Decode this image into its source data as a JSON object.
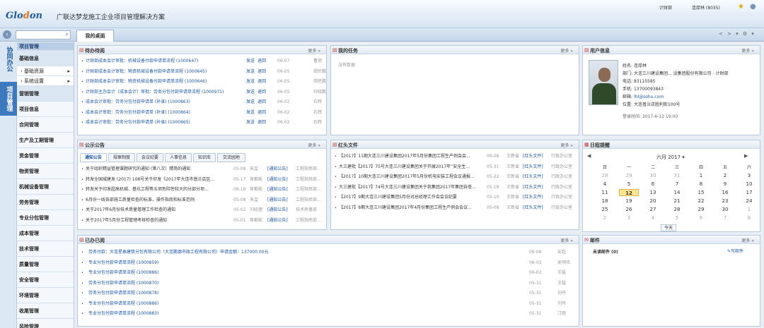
{
  "header": {
    "logo_main": "Glo",
    "logo_accent": "d",
    "logo_tail": "on",
    "title": "广联达梦龙施工企业项目管理解决方案",
    "dept": "计财部",
    "user": "连厚林 (8035)",
    "star_icon": "star-icon",
    "help_icon": "help-icon"
  },
  "tabbar": {
    "search_placeholder": "",
    "active_tab": "我的桌面",
    "tools": "< > ▾ ⚙ ▾"
  },
  "side_tabs": [
    {
      "label": "协同办公"
    },
    {
      "label": "项目管理"
    }
  ],
  "menu": {
    "top": "项目管理",
    "items": [
      {
        "label": "基础信息",
        "type": "group"
      },
      {
        "label": "基础资源",
        "type": "sub"
      },
      {
        "label": "系统设置",
        "type": "sub"
      },
      {
        "label": "营销管理"
      },
      {
        "label": "项目信息"
      },
      {
        "label": "合同管理"
      },
      {
        "label": "生产及工期管理"
      },
      {
        "label": "资金管理"
      },
      {
        "label": "物资管理"
      },
      {
        "label": "机械设备管理"
      },
      {
        "label": "劳务管理"
      },
      {
        "label": "专业分包管理"
      },
      {
        "label": "成本管理"
      },
      {
        "label": "技术管理"
      },
      {
        "label": "质量管理"
      },
      {
        "label": "安全管理"
      },
      {
        "label": "环境管理"
      },
      {
        "label": "收尾管理"
      },
      {
        "label": "风险管理"
      }
    ]
  },
  "todo": {
    "title": "待办待阅",
    "more": "更多 »",
    "rows": [
      {
        "text": "计财部成本会计审批：机械设备付款申请单流程 (1000647)",
        "act1": "发送",
        "act2": "退回",
        "date": "06-07",
        "who": "曹旭"
      },
      {
        "text": "计财部成本会计审批：物资机械设备付款申请单流程 (1000645)",
        "act1": "发送",
        "act2": "退回",
        "date": "06-05",
        "who": "郑民鹏"
      },
      {
        "text": "计财部成本会计审批：物资机械设备付款申请单流程 (1000646)",
        "act1": "发送",
        "act2": "退回",
        "date": "06-05",
        "who": "郑民鹏"
      },
      {
        "text": "计财部主办会计（成本会计）审批：劳务分包付款申请单流程 (1000971)",
        "act1": "发送",
        "act2": "退回",
        "date": "06-05",
        "who": "孙晓鹏"
      },
      {
        "text": "成本会计审批：劳务分包付款申请单 (补录) (1000863)",
        "act1": "发送",
        "act2": "退回",
        "date": "06-02",
        "who": "石辉"
      },
      {
        "text": "成本会计审批：劳务分包付款申请单 (补录) (1000864)",
        "act1": "发送",
        "act2": "退回",
        "date": "06-02",
        "who": "石辉"
      },
      {
        "text": "成本会计审批：劳务分包付款申请单 (补录) (1000865)",
        "act1": "发送",
        "act2": "退回",
        "date": "06-02",
        "who": "石辉"
      }
    ]
  },
  "tasks": {
    "title": "我的任务",
    "more": "更多 »",
    "empty": "没有数据"
  },
  "user": {
    "title": "用户信息",
    "more": "更多 »",
    "name_label": "姓名:",
    "name": "连厚林",
    "dept_label": "部门:",
    "dept": "大连三川建设集团... 设集团股份有限公司 - 计财部",
    "phone_label": "电话:",
    "phone": "83115585",
    "mobile_label": "手机:",
    "mobile": "13700093843",
    "email_label": "邮箱:",
    "email": "lhl@sohu.com",
    "loc_label": "位置:",
    "loc": "大连普兰店胜利街100号",
    "login_label": "登录时间:",
    "login": "2017-6-12 19:00"
  },
  "notices": {
    "title": "公示公告",
    "more": "更多 »",
    "tabs": [
      "通知公告",
      "规章制度",
      "会议纪要",
      "人事信息",
      "知识库",
      "交流园地"
    ],
    "rows": [
      {
        "text": "关于组织精益管理课题研究的通知 (第八次）精简的通知",
        "date": "05-08",
        "who": "朱玺",
        "cat": "[通知公告]",
        "src": "工程指挥部..."
      },
      {
        "text": "转发全国城建发 (2017) 108号关于印发《2017年大连市普兰店区...",
        "date": "05-17",
        "who": "首都能",
        "cat": "[通知公告]",
        "src": "工程指挥部..."
      },
      {
        "text": "转发关于印发超高机械、基坑工程等五项危险性较大的分部分项...",
        "date": "06-16",
        "who": "首都能",
        "cat": "[通知公告]",
        "src": "工程指挥部..."
      },
      {
        "text": "6月份一线各部施工质量检查的标准，操作指南和标准范例",
        "date": "05-08",
        "who": "朱玺",
        "cat": "[通知公告]",
        "src": "工程指挥部..."
      },
      {
        "text": "关于2017年6月份技术质量管理工作检查的通知",
        "date": "05-02",
        "who": "刘经理",
        "cat": "[通知公告]",
        "src": "技术质量部"
      },
      {
        "text": "关于2017年5月份工程管理考核检查的通知",
        "date": "05-01",
        "who": "首都能",
        "cat": "[通知公告]",
        "src": "工程指挥部..."
      }
    ]
  },
  "redhead": {
    "title": "红头文件",
    "more": "更多 »",
    "rows": [
      {
        "text": "【2017】11期大连三川建设集团2017年5月份集团工程生产例会会...",
        "date": "06-08",
        "who": "王新省",
        "cat": "[红头文件]",
        "src": "行政办公室"
      },
      {
        "text": "大三建批【2017】75号大连三川建设集团关于开展2017年“安全生...",
        "date": "05-31",
        "who": "王新省",
        "cat": "[红头文件]",
        "src": "行政办公室"
      },
      {
        "text": "【2017】10期大连三川建设集团2017年5月份机电安装工程会议通报...",
        "date": "05-22",
        "who": "王新省",
        "cat": "[红头文件]",
        "src": "行政办公室"
      },
      {
        "text": "大三建批【2017】74号大连三川建设集团关于我集团2017年集团自查...",
        "date": "05-18",
        "who": "王新省",
        "cat": "[红头文件]",
        "src": "行政办公室"
      },
      {
        "text": "【2017】9期大连三川建设集团5月份对总经理工作会会议纪要",
        "date": "05-10",
        "who": "王新省",
        "cat": "[红头文件]",
        "src": "行政办公室"
      },
      {
        "text": "【2017】8期大连三川建设集团2017年4月份集团工程生产例会会议...",
        "date": "05-08",
        "who": "王新省",
        "cat": "[红头文件]",
        "src": "行政办公室"
      }
    ]
  },
  "calendar": {
    "title": "日程提醒",
    "month": "六月 2017 ▾",
    "prev": "◀",
    "next": "▶",
    "weekdays": [
      "日",
      "一",
      "二",
      "三",
      "四",
      "五",
      "六"
    ],
    "weeks": [
      [
        "28",
        "29",
        "30",
        "31",
        "1",
        "2",
        "3"
      ],
      [
        "4",
        "5",
        "6",
        "7",
        "8",
        "9",
        "10"
      ],
      [
        "11",
        "12",
        "13",
        "14",
        "15",
        "16",
        "17"
      ],
      [
        "18",
        "19",
        "20",
        "21",
        "22",
        "23",
        "24"
      ],
      [
        "25",
        "26",
        "27",
        "28",
        "29",
        "30",
        "1"
      ],
      [
        "2",
        "3",
        "4",
        "5",
        "6",
        "7",
        "8"
      ]
    ],
    "today": "今天"
  },
  "done": {
    "title": "已办已阅",
    "more": "更多 »",
    "rows": [
      {
        "text": "劳务付款：大连星泰建筑分包有限公司（大连鹏德市政工程有限公司）申请金额：137000.00元",
        "date": "06-08",
        "who": "安超"
      },
      {
        "text": "专业分包付款申请单流程 (1000859)",
        "date": "06-03",
        "who": "吴明伟"
      },
      {
        "text": "专业分包付款申请单流程 (1000886)",
        "date": "06-02",
        "who": "王猛"
      },
      {
        "text": "劳务分包付款申请单流程 (1000870)",
        "date": "05-31",
        "who": "王猛"
      },
      {
        "text": "劳务分包付款申请单流程 (1000878)",
        "date": "05-31",
        "who": "刘丹"
      },
      {
        "text": "专业分包付款申请单流程 (1000886)",
        "date": "05-31",
        "who": "刘丹"
      },
      {
        "text": "专业分包付款申请单流程 (1000883)",
        "date": "05-31",
        "who": "汀丽"
      }
    ]
  },
  "mail": {
    "title": "邮件",
    "more": "更多 »",
    "unread": "未读邮件 (0)",
    "write": "写邮件"
  }
}
